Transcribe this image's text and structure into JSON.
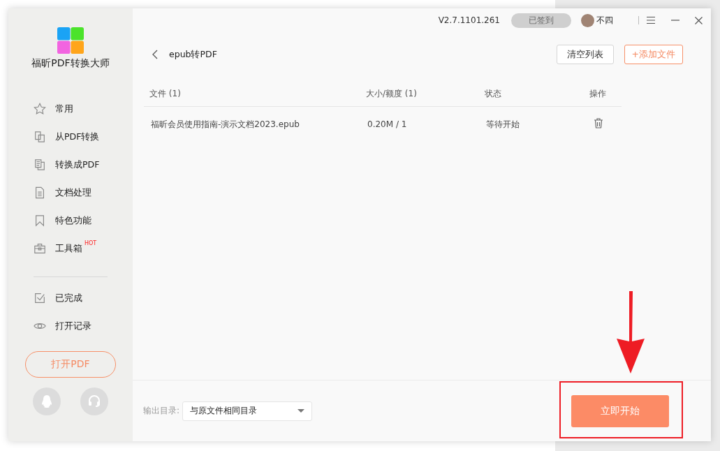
{
  "app": {
    "name": "福昕PDF转换大师"
  },
  "sidebar": {
    "items": [
      {
        "kind": "star",
        "label": "常用"
      },
      {
        "kind": "from-pdf",
        "label": "从PDF转换"
      },
      {
        "kind": "to-pdf",
        "label": "转换成PDF"
      },
      {
        "kind": "document",
        "label": "文档处理"
      },
      {
        "kind": "bookmark",
        "label": "特色功能"
      },
      {
        "kind": "toolbox",
        "label": "工具箱",
        "badge": "HOT"
      }
    ],
    "bottom_items": [
      {
        "kind": "check",
        "label": "已完成"
      },
      {
        "kind": "eye",
        "label": "打开记录"
      }
    ],
    "open_button": "打开PDF"
  },
  "title_bar": {
    "version": "V2.7.1101.261",
    "sign_in": {
      "label": "已签到",
      "disabled": true
    },
    "user": "不四"
  },
  "page": {
    "title": "epub转PDF",
    "buttons": [
      {
        "kind": "plain",
        "label": "清空列表"
      },
      {
        "kind": "accent",
        "label": "+添加文件"
      }
    ]
  },
  "table": {
    "columns": [
      "文件 (1)",
      "大小/额度 (1)",
      "状态",
      "操作"
    ],
    "rows": [
      {
        "file": "福昕会员使用指南-演示文档2023.epub",
        "size": "0.20M / 1",
        "status": "等待开始"
      }
    ]
  },
  "footer": {
    "output_label": "输出目录:",
    "output_value": "与原文件相同目录",
    "start_button": "立即开始"
  }
}
